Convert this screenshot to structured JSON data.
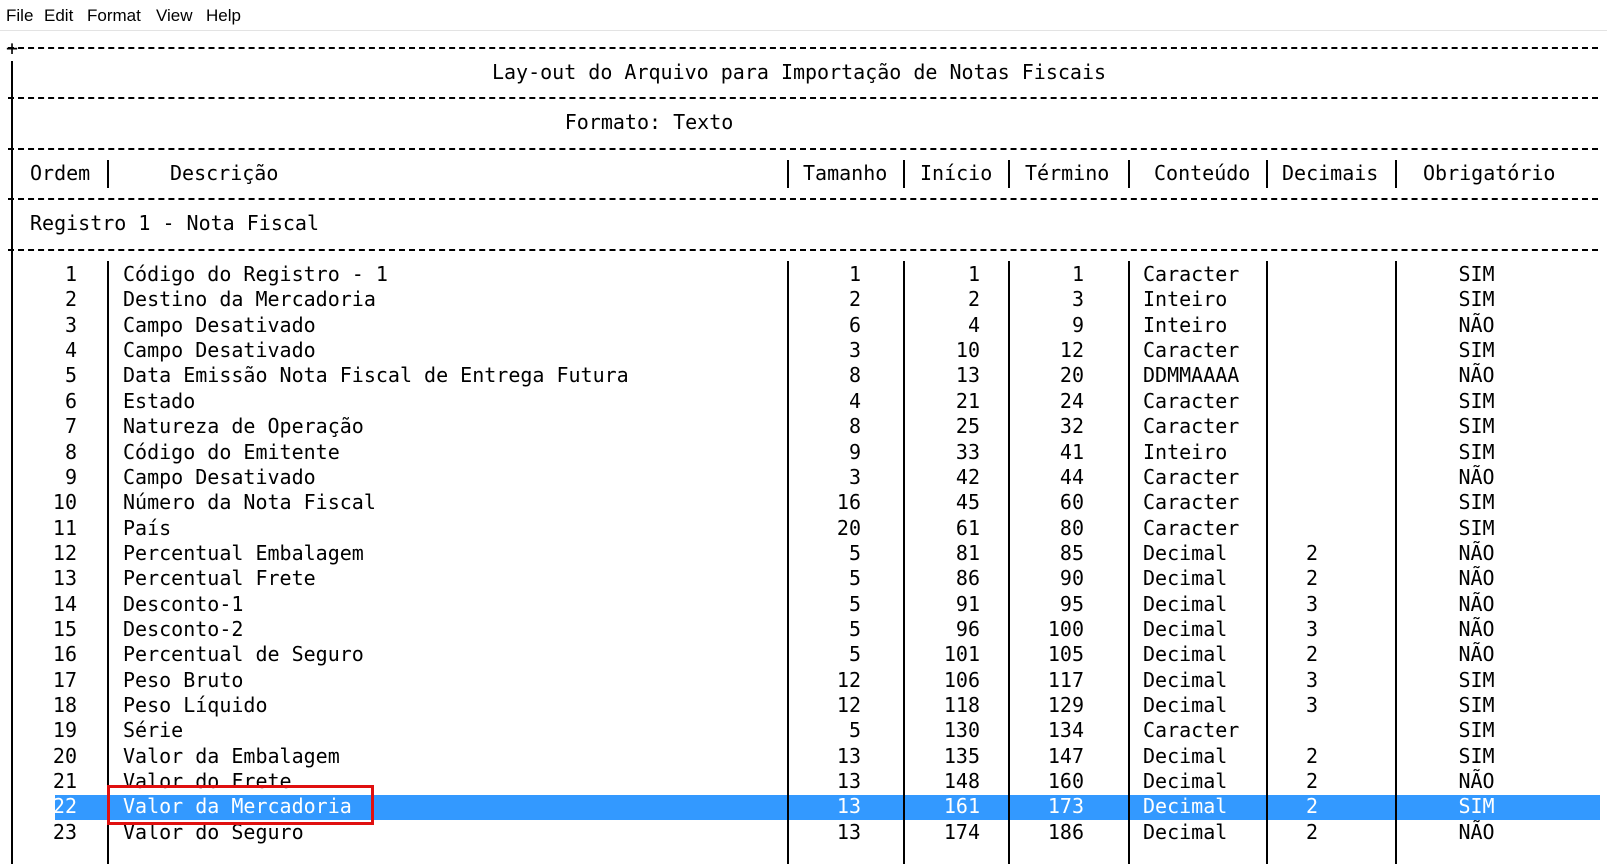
{
  "menu": [
    "File",
    "Edit",
    "Format",
    "View",
    "Help"
  ],
  "doc": {
    "title": "Lay-out do Arquivo para Importação de Notas Fiscais",
    "format": "Formato: Texto",
    "headers": [
      "Ordem",
      "Descrição",
      "Tamanho",
      "Início",
      "Término",
      "Conteúdo",
      "Decimais",
      "Obrigatório"
    ],
    "section": "Registro 1 - Nota Fiscal",
    "rows": [
      [
        "1",
        "Código do Registro - 1",
        "1",
        "1",
        "1",
        "Caracter",
        "",
        "SIM"
      ],
      [
        "2",
        "Destino da Mercadoria",
        "2",
        "2",
        "3",
        "Inteiro",
        "",
        "SIM"
      ],
      [
        "3",
        "Campo Desativado",
        "6",
        "4",
        "9",
        "Inteiro",
        "",
        "NÃO"
      ],
      [
        "4",
        "Campo Desativado",
        "3",
        "10",
        "12",
        "Caracter",
        "",
        "SIM"
      ],
      [
        "5",
        "Data Emissão Nota Fiscal de Entrega Futura",
        "8",
        "13",
        "20",
        "DDMMAAAA",
        "",
        "NÃO"
      ],
      [
        "6",
        "Estado",
        "4",
        "21",
        "24",
        "Caracter",
        "",
        "SIM"
      ],
      [
        "7",
        "Natureza de Operação",
        "8",
        "25",
        "32",
        "Caracter",
        "",
        "SIM"
      ],
      [
        "8",
        "Código do Emitente",
        "9",
        "33",
        "41",
        "Inteiro",
        "",
        "SIM"
      ],
      [
        "9",
        "Campo Desativado",
        "3",
        "42",
        "44",
        "Caracter",
        "",
        "NÃO"
      ],
      [
        "10",
        "Número da Nota Fiscal",
        "16",
        "45",
        "60",
        "Caracter",
        "",
        "SIM"
      ],
      [
        "11",
        "País",
        "20",
        "61",
        "80",
        "Caracter",
        "",
        "SIM"
      ],
      [
        "12",
        "Percentual Embalagem",
        "5",
        "81",
        "85",
        "Decimal",
        "2",
        "NÃO"
      ],
      [
        "13",
        "Percentual Frete",
        "5",
        "86",
        "90",
        "Decimal",
        "2",
        "NÃO"
      ],
      [
        "14",
        "Desconto-1",
        "5",
        "91",
        "95",
        "Decimal",
        "3",
        "NÃO"
      ],
      [
        "15",
        "Desconto-2",
        "5",
        "96",
        "100",
        "Decimal",
        "3",
        "NÃO"
      ],
      [
        "16",
        "Percentual de Seguro",
        "5",
        "101",
        "105",
        "Decimal",
        "2",
        "NÃO"
      ],
      [
        "17",
        "Peso Bruto",
        "12",
        "106",
        "117",
        "Decimal",
        "3",
        "SIM"
      ],
      [
        "18",
        "Peso Líquido",
        "12",
        "118",
        "129",
        "Decimal",
        "3",
        "SIM"
      ],
      [
        "19",
        "Série",
        "5",
        "130",
        "134",
        "Caracter",
        "",
        "SIM"
      ],
      [
        "20",
        "Valor da Embalagem",
        "13",
        "135",
        "147",
        "Decimal",
        "2",
        "SIM"
      ],
      [
        "21",
        "Valor do Frete",
        "13",
        "148",
        "160",
        "Decimal",
        "2",
        "NÃO"
      ],
      [
        "22",
        "Valor da Mercadoria",
        "13",
        "161",
        "173",
        "Decimal",
        "2",
        "SIM"
      ],
      [
        "23",
        "Valor do Seguro",
        "13",
        "174",
        "186",
        "Decimal",
        "2",
        "NÃO"
      ]
    ],
    "selected_row": 22,
    "colors": {
      "selection": "#3399ff",
      "highlight_box": "#e01010"
    }
  }
}
